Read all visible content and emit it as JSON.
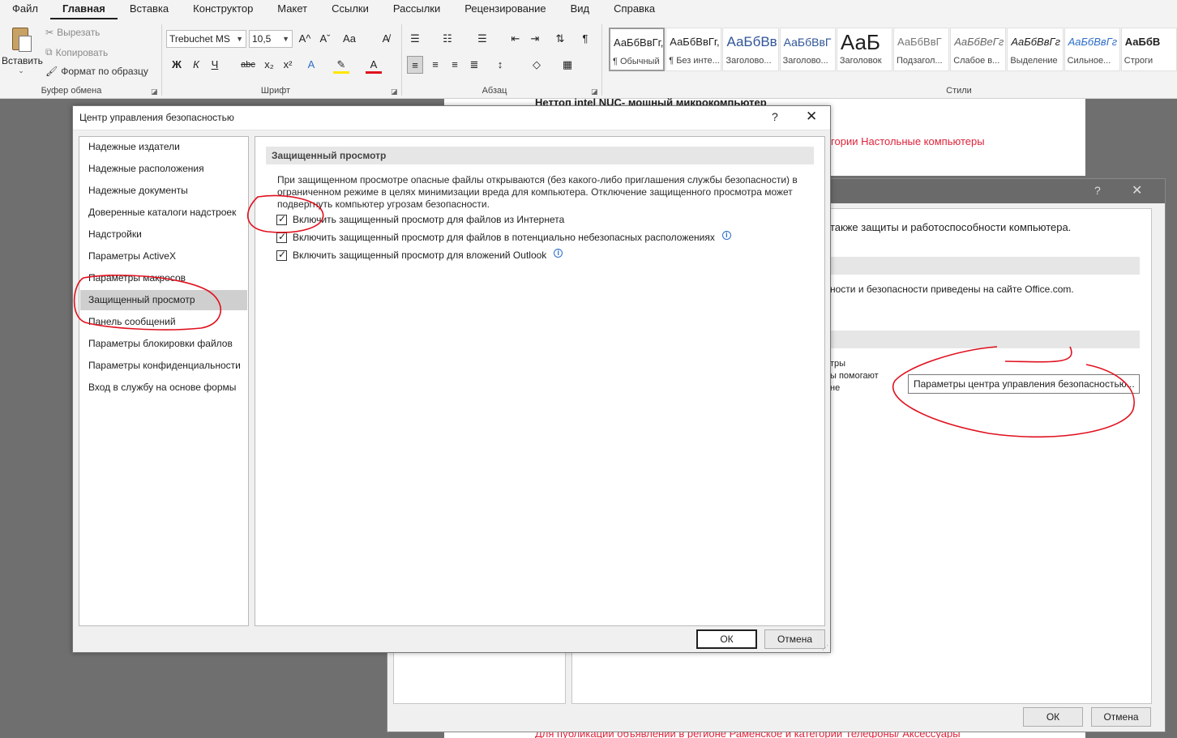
{
  "ribbon": {
    "tabs": [
      "Файл",
      "Главная",
      "Вставка",
      "Конструктор",
      "Макет",
      "Ссылки",
      "Рассылки",
      "Рецензирование",
      "Вид",
      "Справка"
    ],
    "active_tab": "Главная",
    "clipboard": {
      "paste_label": "Вставить",
      "cut_label": "Вырезать",
      "copy_label": "Копировать",
      "format_painter_label": "Формат по образцу",
      "group_label": "Буфер обмена"
    },
    "font": {
      "font_name": "Trebuchet MS",
      "font_size": "10,5",
      "bold": "Ж",
      "italic": "К",
      "underline": "Ч",
      "strikethrough": "abc",
      "subscript": "x₂",
      "superscript": "x²",
      "grow": "A^",
      "shrink": "Aˇ",
      "case": "Aa",
      "group_label": "Шрифт"
    },
    "paragraph": {
      "group_label": "Абзац"
    },
    "styles": {
      "group_label": "Стили",
      "items": [
        {
          "preview": "АаБбВвГг,",
          "name": "¶ Обычный"
        },
        {
          "preview": "АаБбВвГг,",
          "name": "¶ Без инте..."
        },
        {
          "preview": "АаБбВв",
          "name": "Заголово..."
        },
        {
          "preview": "АаБбВвГ",
          "name": "Заголово..."
        },
        {
          "preview": "АаБ",
          "name": "Заголовок"
        },
        {
          "preview": "АаБбВвГ",
          "name": "Подзагол..."
        },
        {
          "preview": "АаБбВеГг",
          "name": "Слабое в..."
        },
        {
          "preview": "АаБбВвГг",
          "name": "Выделение"
        },
        {
          "preview": "АаБбВвГг",
          "name": "Сильное..."
        },
        {
          "preview": "АаБбВ",
          "name": "Строги"
        }
      ]
    }
  },
  "document": {
    "heading_fragment": "Неттоп intel NUC- мощный микрокомпьютер",
    "red_text_top": "тегории Настольные компьютеры",
    "red_text_bottom": "Для публикации объявлений в регионе Раменское и категории Телефоны/ Аксессуары"
  },
  "options_dialog": {
    "help": "?",
    "close": "✕",
    "text_protection": "также защиты и работоспособности компьютера.",
    "text_office": "ности и безопасности приведены на сайте Office.com.",
    "frag_1": "тры",
    "frag_2": "ы помогают",
    "frag_3": "не",
    "settings_button": "Параметры центра управления безопасностью...",
    "ok": "ОК",
    "cancel": "Отмена"
  },
  "trust_center": {
    "title": "Центр управления безопасностью",
    "help": "?",
    "close": "✕",
    "nav_items": [
      "Надежные издатели",
      "Надежные расположения",
      "Надежные документы",
      "Доверенные каталоги надстроек",
      "Надстройки",
      "Параметры ActiveX",
      "Параметры макросов",
      "Защищенный просмотр",
      "Панель сообщений",
      "Параметры блокировки файлов",
      "Параметры конфиденциальности",
      "Вход в службу на основе формы"
    ],
    "active_nav": "Защищенный просмотр",
    "section_title": "Защищенный просмотр",
    "description": "При защищенном просмотре опасные файлы открываются (без какого-либо приглашения службы безопасности) в ограниченном режиме в целях минимизации вреда для компьютера. Отключение защищенного просмотра может подвергнуть компьютер угрозам безопасности.",
    "checkboxes": [
      {
        "label": "Включить защищенный просмотр для файлов из Интернета",
        "checked": true,
        "info": false
      },
      {
        "label": "Включить защищенный просмотр для файлов в потенциально небезопасных расположениях",
        "checked": true,
        "info": true
      },
      {
        "label": "Включить защищенный просмотр для вложений Outlook",
        "checked": true,
        "info": true
      }
    ],
    "ok": "ОК",
    "cancel": "Отмена"
  },
  "colors": {
    "annotation": "#e0101e",
    "red_text": "#e0233b"
  }
}
